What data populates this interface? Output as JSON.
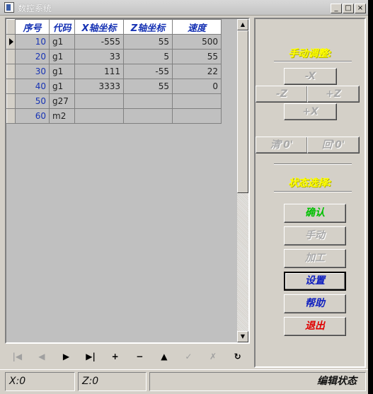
{
  "window": {
    "title": "数控系统",
    "minimize": "_",
    "maximize": "□",
    "close": "×"
  },
  "grid": {
    "headers": [
      "序号",
      "代码",
      "X轴坐标",
      "Z轴坐标",
      "速度"
    ],
    "rows": [
      {
        "seq": "10",
        "code": "g1",
        "x": "-555",
        "z": "55",
        "speed": "500",
        "current": true
      },
      {
        "seq": "20",
        "code": "g1",
        "x": "33",
        "z": "5",
        "speed": "55"
      },
      {
        "seq": "30",
        "code": "g1",
        "x": "111",
        "z": "-55",
        "speed": "22"
      },
      {
        "seq": "40",
        "code": "g1",
        "x": "3333",
        "z": "55",
        "speed": "0"
      },
      {
        "seq": "50",
        "code": "g27",
        "x": "",
        "z": "",
        "speed": ""
      },
      {
        "seq": "60",
        "code": "m2",
        "x": "",
        "z": "",
        "speed": ""
      }
    ]
  },
  "navigator": {
    "first": "|◀",
    "prior": "◀",
    "next": "▶",
    "last": "▶|",
    "insert": "+",
    "delete": "−",
    "edit": "▲",
    "post": "✓",
    "cancel": "✗",
    "refresh": "↻"
  },
  "manual_adjust": {
    "label": "手动调整:",
    "x_minus": "-X",
    "z_minus": "-Z",
    "z_plus": "+Z",
    "x_plus": "+X",
    "clear_zero": "清'0'",
    "return_zero": "回'0'"
  },
  "state_select": {
    "label": "状态选择:",
    "confirm": "确认",
    "manual": "手动",
    "machining": "加工",
    "settings": "设置",
    "help": "帮助",
    "exit": "退出"
  },
  "status": {
    "x": "X:0",
    "z": "Z:0",
    "mode": "编辑状态"
  }
}
